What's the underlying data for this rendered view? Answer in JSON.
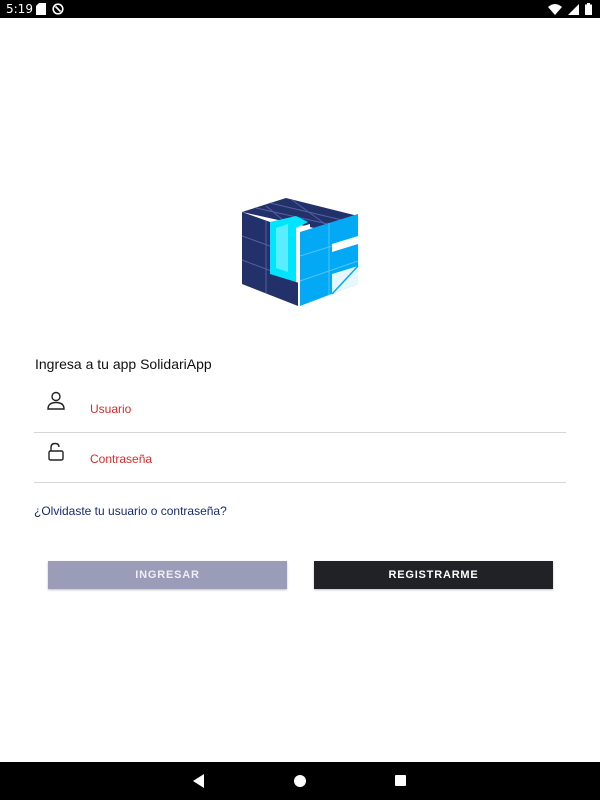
{
  "status_bar": {
    "time": "5:19",
    "left_icons": [
      "sd-card-icon",
      "sync-icon"
    ],
    "right_icons": [
      "wifi-icon",
      "signal-icon",
      "battery-icon"
    ]
  },
  "logo": {
    "name": "solidariapp-logo",
    "colors": [
      "#23316b",
      "#1a2a70",
      "#00e5ff",
      "#03a9f4",
      "#ffffff"
    ]
  },
  "login": {
    "subtitle": "Ingresa a tu app SolidariApp",
    "username_placeholder": "Usuario",
    "password_placeholder": "Contraseña",
    "username_icon": "user-icon",
    "password_icon": "unlock-icon",
    "forgot_link": "¿Olvidaste tu usuario o contraseña?",
    "login_button": "INGRESAR",
    "register_button": "REGISTRARME"
  },
  "colors": {
    "placeholder": "#d32f2f",
    "link": "#1a2a70",
    "login_button_bg": "#9b9cb8",
    "register_button_bg": "#202226"
  },
  "nav_bar": {
    "icons": [
      "back-icon",
      "home-icon",
      "recents-icon"
    ]
  }
}
